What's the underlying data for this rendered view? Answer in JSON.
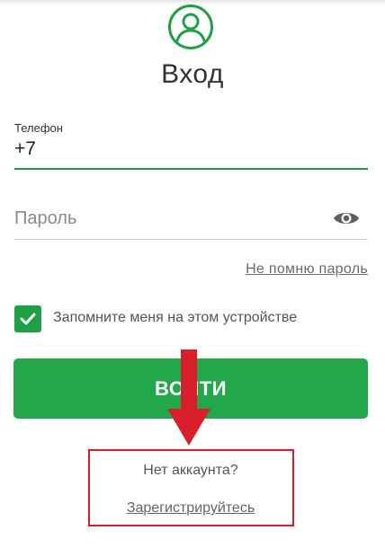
{
  "colors": {
    "accent_green": "#22a84b",
    "annotation_red": "#d32027"
  },
  "header": {
    "avatar_icon": "user-avatar-icon",
    "title": "Вход"
  },
  "form": {
    "phone": {
      "label": "Телефон",
      "value": "+7"
    },
    "password": {
      "placeholder": "Пароль",
      "toggle_icon": "eye-icon"
    },
    "forgot_password_link": "Не помню пароль",
    "remember_me": {
      "label": "Запомните меня на этом устройстве",
      "checked": true
    },
    "login_button_label": "ВОЙТИ"
  },
  "register": {
    "prompt": "Нет аккаунта?",
    "link_label": "Зарегистрируйтесь"
  },
  "annotation": {
    "arrow_icon": "red-down-arrow-icon",
    "highlight_box": "red-highlight-box"
  }
}
